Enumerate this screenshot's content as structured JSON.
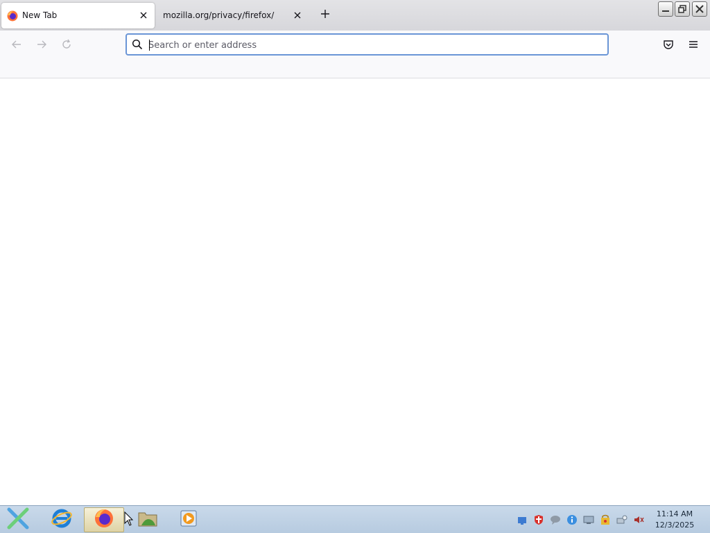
{
  "tabs": [
    {
      "label": "New Tab",
      "active": true,
      "favicon": "firefox-icon"
    },
    {
      "label": "mozilla.org/privacy/firefox/",
      "active": false,
      "favicon": ""
    }
  ],
  "urlbar": {
    "placeholder": "Search or enter address",
    "value": ""
  },
  "navbar": {
    "back_icon": "back-arrow-icon",
    "forward_icon": "forward-arrow-icon",
    "reload_icon": "reload-icon",
    "pocket_icon": "pocket-icon",
    "menu_icon": "hamburger-menu-icon"
  },
  "taskbar": {
    "apps": [
      "start-icon",
      "internet-explorer-icon",
      "firefox-icon",
      "file-manager-icon",
      "media-player-icon"
    ],
    "tray_icons": [
      "network-icon",
      "shield-icon",
      "chat-icon",
      "info-icon",
      "display-icon",
      "security-alert-icon",
      "connection-icon",
      "volume-muted-icon"
    ],
    "clock": {
      "time": "11:14 AM",
      "date": "12/3/2025"
    }
  },
  "colors": {
    "accent": "#6a95d6",
    "tabstrip": "#e0e0e4",
    "taskbar": "#c2d4e8"
  }
}
